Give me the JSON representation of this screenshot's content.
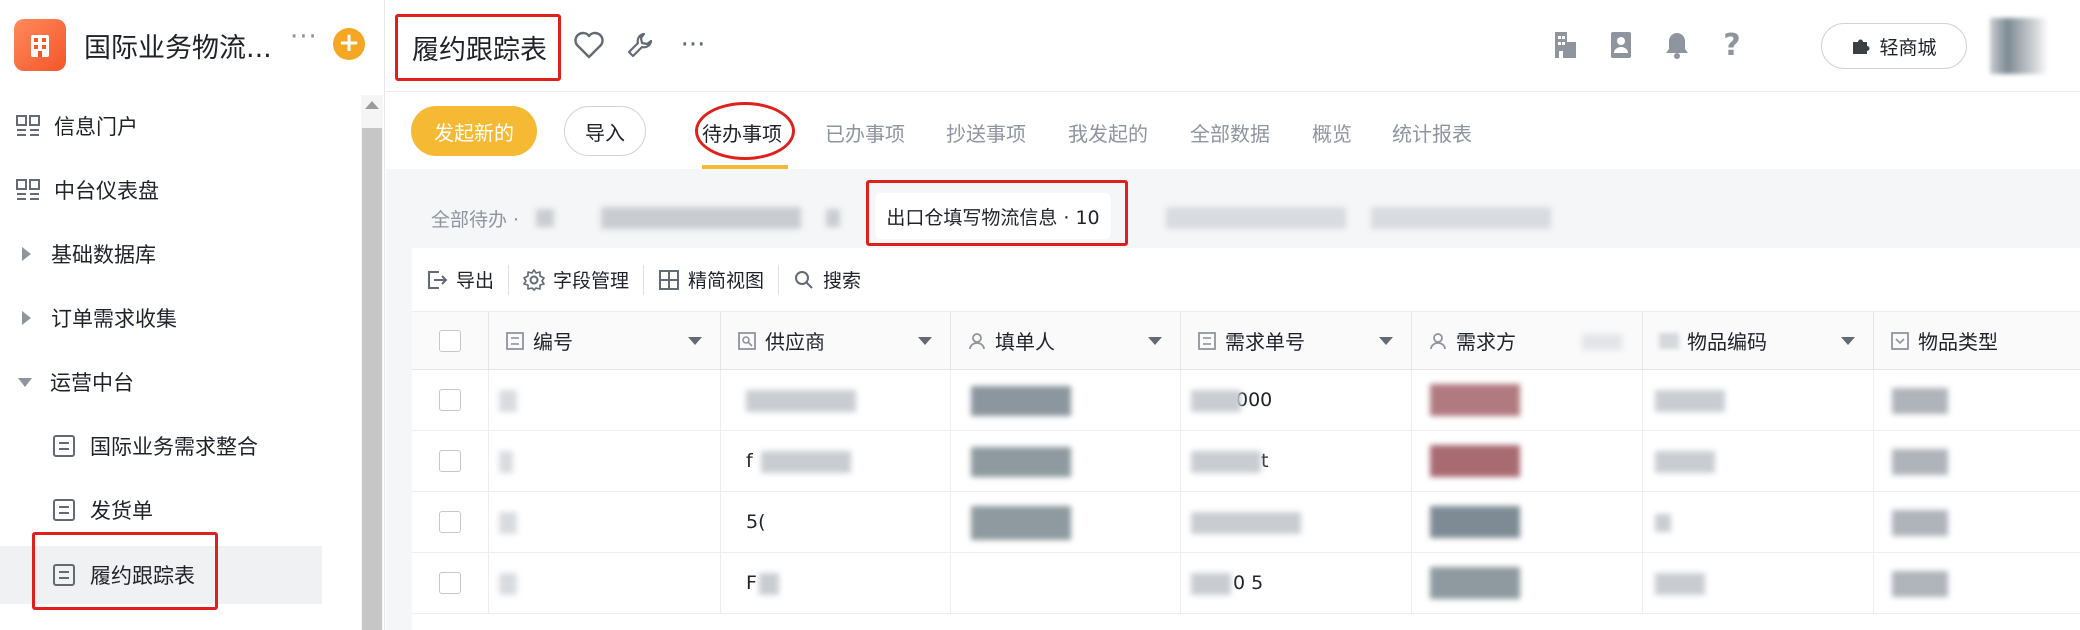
{
  "app": {
    "title": "国际业务物流...",
    "more": "···",
    "add": "+"
  },
  "sidebar": {
    "items": [
      {
        "label": "信息门户",
        "icon": "portal-icon"
      },
      {
        "label": "中台仪表盘",
        "icon": "dashboard-icon"
      },
      {
        "label": "基础数据库",
        "icon": "caret-right-icon"
      },
      {
        "label": "订单需求收集",
        "icon": "caret-right-icon"
      },
      {
        "label": "运营中台",
        "icon": "caret-down-icon"
      },
      {
        "label": "国际业务需求整合",
        "icon": "form-icon"
      },
      {
        "label": "发货单",
        "icon": "form-icon"
      },
      {
        "label": "履约跟踪表",
        "icon": "form-icon"
      }
    ]
  },
  "header": {
    "title": "履约跟踪表",
    "more": "···",
    "mall_label": "轻商城"
  },
  "actions": {
    "new_label": "发起新的",
    "import_label": "导入"
  },
  "tabs": [
    "待办事项",
    "已办事项",
    "抄送事项",
    "我发起的",
    "全部数据",
    "概览",
    "统计报表"
  ],
  "filters": {
    "all_pending": "全部待办 ·",
    "active": "出口仓填写物流信息 · 10"
  },
  "toolbar": {
    "export": "导出",
    "fields": "字段管理",
    "compact": "精简视图",
    "search": "搜索"
  },
  "columns": [
    "编号",
    "供应商",
    "填单人",
    "需求单号",
    "需求方",
    "物品编码",
    "物品类型"
  ],
  "rows": [
    {
      "supplier": "",
      "req_no": "000"
    },
    {
      "supplier": "f",
      "req_no": "t"
    },
    {
      "supplier": "5(",
      "req_no": ""
    },
    {
      "supplier": "F",
      "req_no": "0 5"
    }
  ],
  "colors": {
    "accent": "#f5b934",
    "annotation": "#e0201c",
    "app_logo": "#f2562a"
  }
}
